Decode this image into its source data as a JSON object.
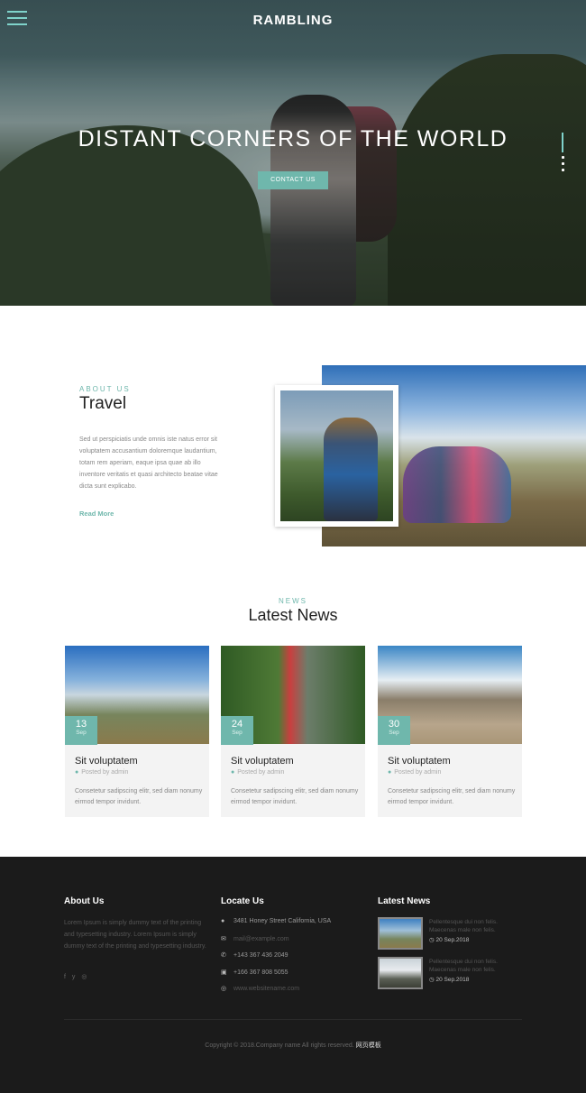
{
  "header": {
    "brand": "RAMBLING",
    "menu_icon": "hamburger-icon"
  },
  "hero": {
    "title": "DISTANT CORNERS OF THE WORLD",
    "button": "CONTACT US",
    "slider_indicator": "slide-dots"
  },
  "about": {
    "kicker": "ABOUT US",
    "title": "Travel",
    "text": "Sed ut perspiciatis unde omnis iste natus error sit voluptatem accusantium doloremque laudantium, totam rem aperiam, eaque ipsa quae ab illo inventore veritatis et quasi architecto beatae vitae dicta sunt explicabo.",
    "link": "Read More"
  },
  "news": {
    "kicker": "NEWS",
    "title": "Latest News",
    "cards": [
      {
        "day": "13",
        "month": "Sep",
        "title": "Sit voluptatem",
        "by": "Posted by admin",
        "text": "Consetetur sadipscing elitr, sed diam nonumy eirmod tempor invidunt."
      },
      {
        "day": "24",
        "month": "Sep",
        "title": "Sit voluptatem",
        "by": "Posted by admin",
        "text": "Consetetur sadipscing elitr, sed diam nonumy eirmod tempor invidunt."
      },
      {
        "day": "30",
        "month": "Sep",
        "title": "Sit voluptatem",
        "by": "Posted by admin",
        "text": "Consetetur sadipscing elitr, sed diam nonumy eirmod tempor invidunt."
      }
    ]
  },
  "footer": {
    "about": {
      "heading": "About Us",
      "text": "Lorem Ipsum is simply dummy text of the printing and typesetting industry. Lorem Ipsum is simply dummy text of the printing and typesetting industry."
    },
    "social": [
      "f",
      "y",
      "◎"
    ],
    "locate": {
      "heading": "Locate Us",
      "address": "3481 Honey Street California, USA",
      "email": "mail@example.com",
      "phone1": "+143 367 436 2049",
      "phone2": "+166 367 808 5055",
      "web": "www.websitename.com"
    },
    "news": {
      "heading": "Latest News",
      "items": [
        {
          "line1": "Pellentesque dui non felis.",
          "line2": "Maecenas male non felis.",
          "date": "20 Sep.2018"
        },
        {
          "line1": "Pellentesque dui non felis.",
          "line2": "Maecenas male non felis.",
          "date": "20 Sep.2018"
        }
      ]
    },
    "copyright": "Copyright © 2018.Company name All rights reserved.",
    "copyright_link": "网页模板"
  },
  "colors": {
    "accent": "#6fb7ac",
    "footer_bg": "#1b1b1b"
  }
}
